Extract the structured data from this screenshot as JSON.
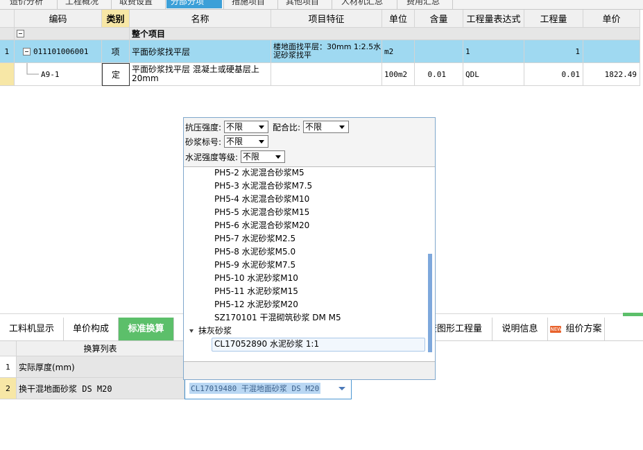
{
  "top_tabs": [
    "造价分析",
    "工程概况",
    "取费设置",
    "分部分项",
    "措施项目",
    "其他项目",
    "人材机汇总",
    "费用汇总"
  ],
  "upper_table": {
    "headers": [
      "编码",
      "类别",
      "名称",
      "项目特征",
      "单位",
      "含量",
      "工程量表达式",
      "工程量",
      "单价"
    ],
    "group_row": {
      "name": "整个项目"
    },
    "rows": [
      {
        "num": "1",
        "code": "011101006001",
        "type": "项",
        "name": "平面砂浆找平层",
        "feature": "楼地面找平层：30mm 1:2.5水泥砂浆找平",
        "unit": "m2",
        "content": "",
        "expr": "1",
        "qty": "1",
        "price": ""
      },
      {
        "num": "",
        "code": "A9-1",
        "type": "定",
        "name": "平面砂浆找平层 混凝土或硬基层上 20mm",
        "feature": "",
        "unit": "100m2",
        "content": "0.01",
        "expr": "QDL",
        "qty": "0.01",
        "price": "1822.49"
      }
    ]
  },
  "popup": {
    "filters": {
      "strength_label": "抗压强度:",
      "strength_value": "不限",
      "ratio_label": "配合比:",
      "ratio_value": "不限",
      "mortar_label": "砂浆标号:",
      "mortar_value": "不限",
      "cement_label": "水泥强度等级:",
      "cement_value": "不限"
    },
    "items": [
      "PH5-2  水泥混合砂浆M5",
      "PH5-3  水泥混合砂浆M7.5",
      "PH5-4  水泥混合砂浆M10",
      "PH5-5  水泥混合砂浆M15",
      "PH5-6  水泥混合砂浆M20",
      "PH5-7  水泥砂浆M2.5",
      "PH5-8  水泥砂浆M5.0",
      "PH5-9  水泥砂浆M7.5",
      "PH5-10  水泥砂浆M10",
      "PH5-11  水泥砂浆M15",
      "PH5-12  水泥砂浆M20",
      "SZ170101  干混砌筑砂浆 DM M5"
    ],
    "group": "抹灰砂浆",
    "selected_item": "CL17052890  水泥砂浆 1:1"
  },
  "bottom_tabs": [
    "工料机显示",
    "单价构成",
    "标准换算",
    "查图形工程量",
    "说明信息",
    "组价方案"
  ],
  "new_badge": "NEW",
  "conversion": {
    "header": "换算列表",
    "rows": [
      {
        "num": "1",
        "label": "实际厚度(mm)"
      },
      {
        "num": "2",
        "label": "换干混地面砂浆 DS M20"
      }
    ],
    "combo_value": "CL17019480  干混地面砂浆 DS M20"
  },
  "colors": {
    "accent_blue": "#3ca0d8",
    "row_selected": "#9fd9f1",
    "active_tab_green": "#5cbf6a",
    "header_highlight": "#f7e7a6"
  }
}
